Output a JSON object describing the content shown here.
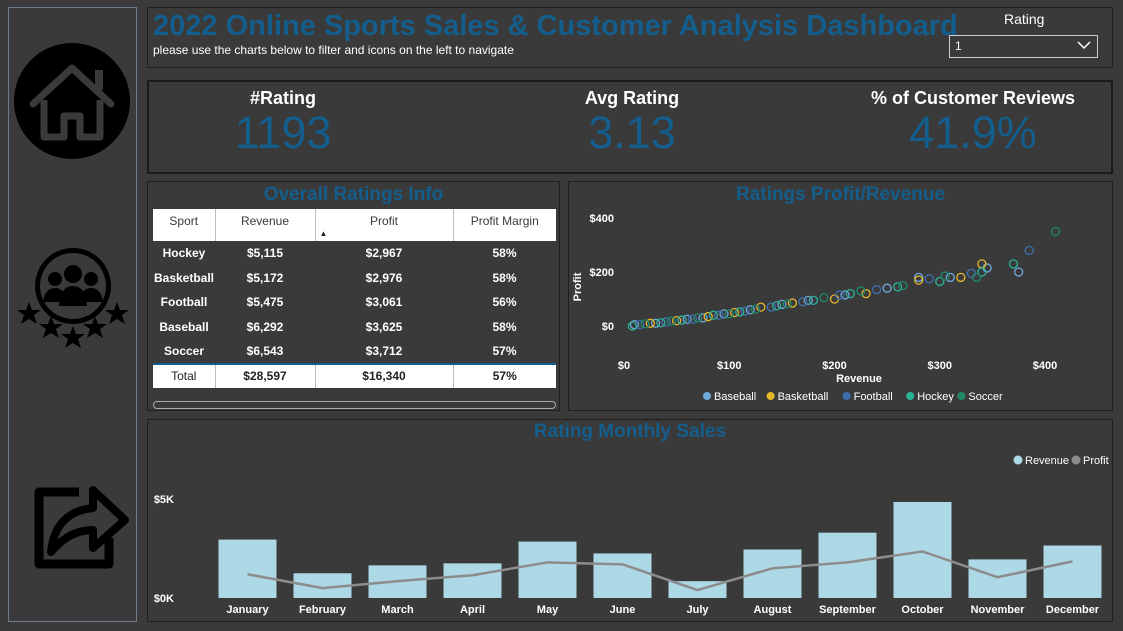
{
  "header": {
    "title": "2022 Online Sports Sales & Customer Analysis Dashboard",
    "subtitle": "please use the charts below to filter and icons on the left to navigate",
    "rating_label": "Rating",
    "rating_value": "1"
  },
  "sidebar": {
    "items": [
      {
        "name": "home-icon"
      },
      {
        "name": "customer-ratings-icon"
      },
      {
        "name": "share-icon"
      }
    ]
  },
  "kpis": [
    {
      "label": "#Rating",
      "value": "1193"
    },
    {
      "label": "Avg Rating",
      "value": "3.13"
    },
    {
      "label": "% of Customer Reviews",
      "value": "41.9%"
    }
  ],
  "ratings_table": {
    "title": "Overall Ratings Info",
    "columns": [
      "Sport",
      "Revenue",
      "Profit",
      "Profit Margin"
    ],
    "rows": [
      [
        "Hockey",
        "$5,115",
        "$2,967",
        "58%"
      ],
      [
        "Basketball",
        "$5,172",
        "$2,976",
        "58%"
      ],
      [
        "Football",
        "$5,475",
        "$3,061",
        "56%"
      ],
      [
        "Baseball",
        "$6,292",
        "$3,625",
        "58%"
      ],
      [
        "Soccer",
        "$6,543",
        "$3,712",
        "57%"
      ]
    ],
    "total": [
      "Total",
      "$28,597",
      "$16,340",
      "57%"
    ]
  },
  "colors": {
    "title_blue": "#135e8c",
    "baseball": "#6fa8dc",
    "basketball": "#e5b82a",
    "football": "#3f6fb0",
    "hockey": "#2bb39a",
    "soccer": "#1e8a6a",
    "revenue": "#add8e6",
    "profit": "#8c8c8c"
  },
  "chart_data": [
    {
      "type": "scatter",
      "title": "Ratings Profit/Revenue",
      "xlabel": "Revenue",
      "ylabel": "Profit",
      "x_ticks": [
        "$0",
        "$100",
        "$200",
        "$300",
        "$400"
      ],
      "y_ticks": [
        "$0",
        "$200",
        "$400"
      ],
      "xlim": [
        0,
        420
      ],
      "ylim": [
        -20,
        420
      ],
      "legend_position": "bottom",
      "series": [
        {
          "name": "Baseball",
          "points": [
            [
              10,
              5
            ],
            [
              30,
              10
            ],
            [
              60,
              25
            ],
            [
              75,
              30
            ],
            [
              95,
              45
            ],
            [
              120,
              60
            ],
            [
              150,
              80
            ],
            [
              175,
              95
            ],
            [
              210,
              115
            ],
            [
              250,
              140
            ],
            [
              280,
              180
            ],
            [
              310,
              180
            ],
            [
              345,
              215
            ],
            [
              375,
              200
            ]
          ]
        },
        {
          "name": "Basketball",
          "points": [
            [
              25,
              10
            ],
            [
              50,
              20
            ],
            [
              80,
              35
            ],
            [
              105,
              50
            ],
            [
              130,
              70
            ],
            [
              160,
              85
            ],
            [
              200,
              100
            ],
            [
              230,
              120
            ],
            [
              280,
              170
            ],
            [
              320,
              180
            ],
            [
              340,
              230
            ]
          ]
        },
        {
          "name": "Football",
          "points": [
            [
              15,
              5
            ],
            [
              40,
              15
            ],
            [
              65,
              25
            ],
            [
              90,
              40
            ],
            [
              115,
              55
            ],
            [
              140,
              70
            ],
            [
              170,
              90
            ],
            [
              205,
              115
            ],
            [
              240,
              135
            ],
            [
              290,
              175
            ],
            [
              330,
              195
            ],
            [
              385,
              280
            ]
          ]
        },
        {
          "name": "Hockey",
          "points": [
            [
              8,
              0
            ],
            [
              35,
              12
            ],
            [
              55,
              22
            ],
            [
              85,
              40
            ],
            [
              110,
              52
            ],
            [
              145,
              75
            ],
            [
              180,
              95
            ],
            [
              215,
              120
            ],
            [
              260,
              145
            ],
            [
              300,
              165
            ],
            [
              340,
              200
            ],
            [
              370,
              230
            ]
          ]
        },
        {
          "name": "Soccer",
          "points": [
            [
              20,
              8
            ],
            [
              45,
              18
            ],
            [
              70,
              30
            ],
            [
              100,
              45
            ],
            [
              125,
              62
            ],
            [
              155,
              82
            ],
            [
              190,
              105
            ],
            [
              225,
              130
            ],
            [
              265,
              150
            ],
            [
              305,
              185
            ],
            [
              335,
              180
            ],
            [
              410,
              350
            ]
          ]
        }
      ]
    },
    {
      "type": "bar",
      "title": "Rating Monthly Sales",
      "categories": [
        "January",
        "February",
        "March",
        "April",
        "May",
        "June",
        "July",
        "August",
        "September",
        "October",
        "November",
        "December"
      ],
      "y_ticks": [
        "$0K",
        "$5K"
      ],
      "ylim": [
        0,
        5000
      ],
      "legend_position": "top-right",
      "series": [
        {
          "name": "Revenue",
          "values": [
            2950,
            1250,
            1650,
            1750,
            2850,
            2250,
            850,
            2450,
            3300,
            4850,
            1950,
            2650
          ]
        },
        {
          "name": "Profit",
          "values": [
            1200,
            500,
            850,
            1150,
            1800,
            1700,
            400,
            1500,
            1800,
            2350,
            1050,
            1850
          ]
        }
      ]
    }
  ]
}
